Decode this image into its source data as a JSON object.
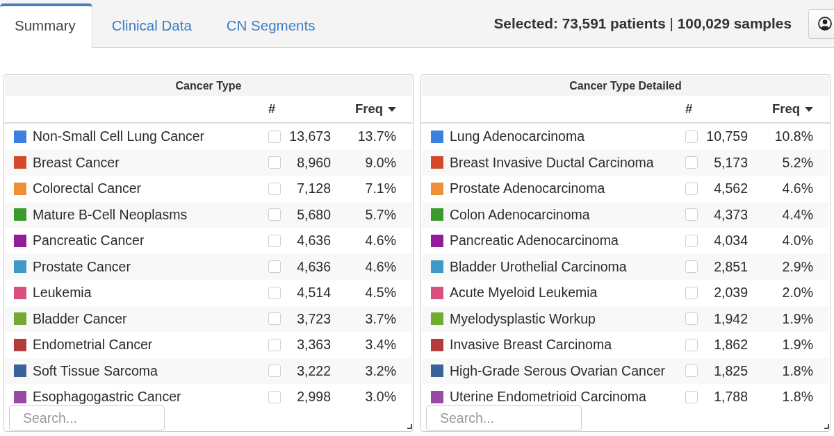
{
  "tabs": [
    {
      "label": "Summary",
      "selected": true
    },
    {
      "label": "Clinical Data",
      "selected": false
    },
    {
      "label": "CN Segments",
      "selected": false
    }
  ],
  "selection": "**Selected: 73,591 patients** | **100,029 samples**",
  "panels": [
    {
      "title": "Cancer Type",
      "columns": [
        {
          "label": "#",
          "sorted": false
        },
        {
          "label": "Freq",
          "sorted": true
        }
      ],
      "rows": [
        {
          "label": "Non-Small Cell Lung Cancer",
          "color": "#3b80de",
          "checked": false,
          "count": "13,673",
          "freq": "13.7%"
        },
        {
          "label": "Breast Cancer",
          "color": "#d44a2c",
          "checked": false,
          "count": "8,960",
          "freq": "9.0%"
        },
        {
          "label": "Colorectal Cancer",
          "color": "#ef8f35",
          "checked": false,
          "count": "7,128",
          "freq": "7.1%"
        },
        {
          "label": "Mature B-Cell Neoplasms",
          "color": "#3b9a2e",
          "checked": false,
          "count": "5,680",
          "freq": "5.7%"
        },
        {
          "label": "Pancreatic Cancer",
          "color": "#931c9c",
          "checked": false,
          "count": "4,636",
          "freq": "4.6%"
        },
        {
          "label": "Prostate Cancer",
          "color": "#3d9ac8",
          "checked": false,
          "count": "4,636",
          "freq": "4.6%"
        },
        {
          "label": "Leukemia",
          "color": "#d9507d",
          "checked": false,
          "count": "4,514",
          "freq": "4.5%"
        },
        {
          "label": "Bladder Cancer",
          "color": "#73aa31",
          "checked": false,
          "count": "3,723",
          "freq": "3.7%"
        },
        {
          "label": "Endometrial Cancer",
          "color": "#b43b3a",
          "checked": false,
          "count": "3,363",
          "freq": "3.4%"
        },
        {
          "label": "Soft Tissue Sarcoma",
          "color": "#3c6399",
          "checked": false,
          "count": "3,222",
          "freq": "3.2%"
        },
        {
          "label": "Esophagogastric Cancer",
          "color": "#994aa4",
          "checked": false,
          "count": "2,998",
          "freq": "3.0%"
        }
      ],
      "search": {
        "placeholder": "Search..."
      }
    },
    {
      "title": "Cancer Type Detailed",
      "columns": [
        {
          "label": "#",
          "sorted": false
        },
        {
          "label": "Freq",
          "sorted": true
        }
      ],
      "rows": [
        {
          "label": "Lung Adenocarcinoma",
          "color": "#3b80de",
          "checked": false,
          "count": "10,759",
          "freq": "10.8%"
        },
        {
          "label": "Breast Invasive Ductal Carcinoma",
          "color": "#d44a2c",
          "checked": false,
          "count": "5,173",
          "freq": "5.2%"
        },
        {
          "label": "Prostate Adenocarcinoma",
          "color": "#ef8f35",
          "checked": false,
          "count": "4,562",
          "freq": "4.6%"
        },
        {
          "label": "Colon Adenocarcinoma",
          "color": "#3b9a2e",
          "checked": false,
          "count": "4,373",
          "freq": "4.4%"
        },
        {
          "label": "Pancreatic Adenocarcinoma",
          "color": "#931c9c",
          "checked": false,
          "count": "4,034",
          "freq": "4.0%"
        },
        {
          "label": "Bladder Urothelial Carcinoma",
          "color": "#3d9ac8",
          "checked": false,
          "count": "2,851",
          "freq": "2.9%"
        },
        {
          "label": "Acute Myeloid Leukemia",
          "color": "#d9507d",
          "checked": false,
          "count": "2,039",
          "freq": "2.0%"
        },
        {
          "label": "Myelodysplastic Workup",
          "color": "#73aa31",
          "checked": false,
          "count": "1,942",
          "freq": "1.9%"
        },
        {
          "label": "Invasive Breast Carcinoma",
          "color": "#b43b3a",
          "checked": false,
          "count": "1,862",
          "freq": "1.9%"
        },
        {
          "label": "High-Grade Serous Ovarian Cancer",
          "color": "#3c6399",
          "checked": false,
          "count": "1,825",
          "freq": "1.8%"
        },
        {
          "label": "Uterine Endometrioid Carcinoma",
          "color": "#994aa4",
          "checked": false,
          "count": "1,788",
          "freq": "1.8%"
        }
      ],
      "search": {
        "placeholder": "Search..."
      }
    }
  ]
}
